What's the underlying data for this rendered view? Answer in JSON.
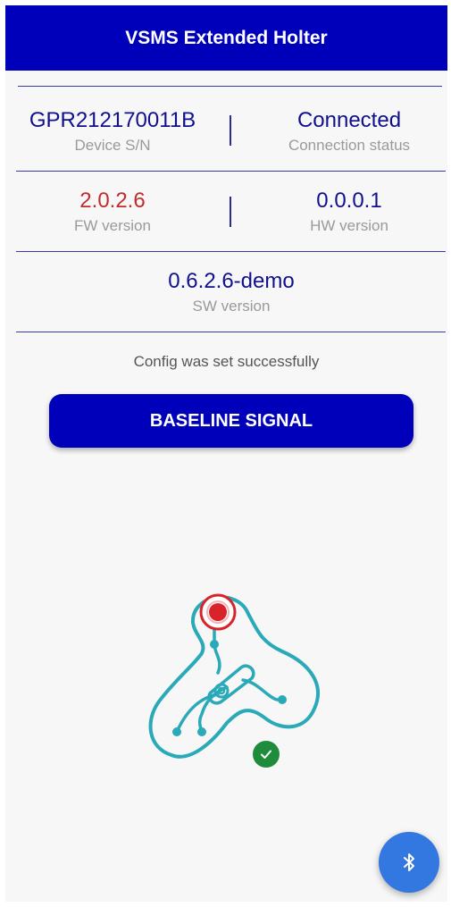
{
  "app_bar": {
    "title": "VSMS Extended Holter"
  },
  "device_info": {
    "serial": {
      "value": "GPR212170011B",
      "caption": "Device S/N"
    },
    "connection": {
      "value": "Connected",
      "caption": "Connection status"
    },
    "fw": {
      "value": "2.0.2.6",
      "caption": "FW version"
    },
    "hw": {
      "value": "0.0.0.1",
      "caption": "HW version"
    },
    "sw": {
      "value": "0.6.2.6-demo",
      "caption": "SW version"
    }
  },
  "status_message": "Config was set successfully",
  "baseline_button_label": "BASELINE SIGNAL",
  "illustration": {
    "icon": "holter-device-illustration",
    "status_icon": "check-icon",
    "status": "success"
  },
  "fab": {
    "icon": "bluetooth-icon"
  },
  "colors": {
    "primary": "#0000bb",
    "text_value": "#10108f",
    "fw_value": "#c42b2b",
    "device_outline": "#2aa9b8",
    "electrode_red": "#d8232a",
    "success_green": "#1e8c3a",
    "fab": "#3377e0"
  }
}
